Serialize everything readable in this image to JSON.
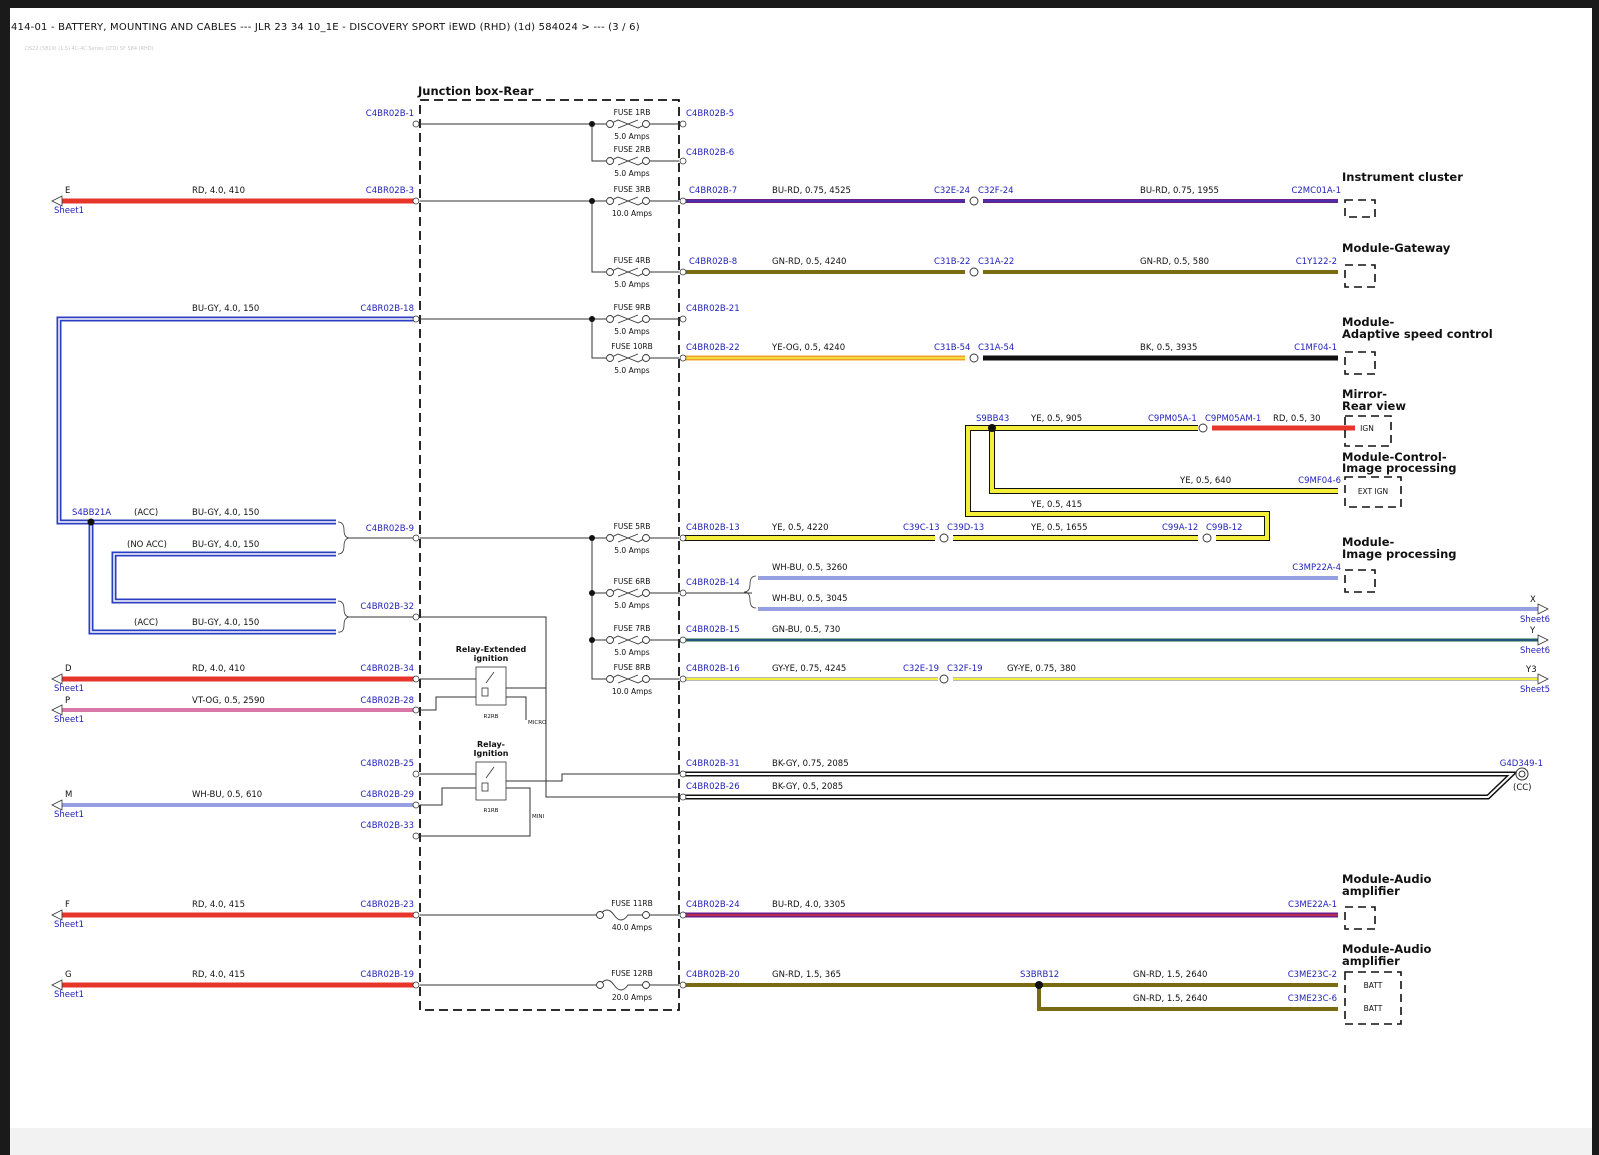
{
  "header": {
    "title": "414-01 - BATTERY, MOUNTING AND CABLES --- JLR 23 34 10_1E - DISCOVERY SPORT iEWD (RHD) (1d) 584024 > --- (3 / 6)",
    "subtitle": "DS22 (5819) (1.5) 4C-4C Series (LTD) 5F 584 (RHD)"
  },
  "junction_box": {
    "title": "Junction box-Rear",
    "relay_extended": [
      "Relay-Extended",
      "ignition"
    ],
    "relay_extended_id": "R2RB",
    "relay_extended_note": "MICRO",
    "relay_ignition": [
      "Relay-",
      "Ignition"
    ],
    "relay_ignition_id": "R1RB",
    "relay_ignition_note": "MINI"
  },
  "fuses": [
    {
      "name": "FUSE 1RB",
      "rating": "5.0 Amps"
    },
    {
      "name": "FUSE 2RB",
      "rating": "5.0 Amps"
    },
    {
      "name": "FUSE 3RB",
      "rating": "10.0 Amps"
    },
    {
      "name": "FUSE 4RB",
      "rating": "5.0 Amps"
    },
    {
      "name": "FUSE 9RB",
      "rating": "5.0 Amps"
    },
    {
      "name": "FUSE 10RB",
      "rating": "5.0 Amps"
    },
    {
      "name": "FUSE 5RB",
      "rating": "5.0 Amps"
    },
    {
      "name": "FUSE 6RB",
      "rating": "5.0 Amps"
    },
    {
      "name": "FUSE 7RB",
      "rating": "5.0 Amps"
    },
    {
      "name": "FUSE 8RB",
      "rating": "10.0 Amps"
    },
    {
      "name": "FUSE 11RB",
      "rating": "40.0 Amps"
    },
    {
      "name": "FUSE 12RB",
      "rating": "20.0 Amps"
    }
  ],
  "left_connectors": {
    "c1": "C4BR02B-1",
    "c3": "C4BR02B-3",
    "c18": "C4BR02B-18",
    "c9": "C4BR02B-9",
    "c32": "C4BR02B-32",
    "c34": "C4BR02B-34",
    "c28": "C4BR02B-28",
    "c25": "C4BR02B-25",
    "c29": "C4BR02B-29",
    "c33": "C4BR02B-33",
    "c23": "C4BR02B-23",
    "c19": "C4BR02B-19"
  },
  "right_connectors": {
    "c5": "C4BR02B-5",
    "c6": "C4BR02B-6",
    "c7": "C4BR02B-7",
    "c8": "C4BR02B-8",
    "c21": "C4BR02B-21",
    "c22": "C4BR02B-22",
    "c13": "C4BR02B-13",
    "c14": "C4BR02B-14",
    "c15": "C4BR02B-15",
    "c16": "C4BR02B-16",
    "c31": "C4BR02B-31",
    "c26": "C4BR02B-26",
    "c24": "C4BR02B-24",
    "c20": "C4BR02B-20"
  },
  "inline_connectors": {
    "c32e24": "C32E-24",
    "c32f24": "C32F-24",
    "c31b22": "C31B-22",
    "c31a22": "C31A-22",
    "c31b54": "C31B-54",
    "c31a54": "C31A-54",
    "c39c13": "C39C-13",
    "c39d13": "C39D-13",
    "c99a12": "C99A-12",
    "c99b12": "C99B-12",
    "c32e19": "C32E-19",
    "c32f19": "C32F-19",
    "c9pm05a1": "C9PM05A-1",
    "c9pm05am1": "C9PM05AM-1"
  },
  "splices": {
    "s4bb21a": "S4BB21A",
    "s9bb43": "S9BB43",
    "s3brb12": "S3BRB12"
  },
  "end_connectors": {
    "c2mc01a1": "C2MC01A-1",
    "c1y1222": "C1Y122-2",
    "c1mf041": "C1MF04-1",
    "c9mf046": "C9MF04-6",
    "c3mp22a4": "C3MP22A-4",
    "c3me22a1": "C3ME22A-1",
    "c3me23c2": "C3ME23C-2",
    "c3me23c6": "C3ME23C-6",
    "g4d3491": "G4D349-1",
    "cc": "(CC)"
  },
  "wires": {
    "w_e": "RD, 4.0, 410",
    "w_18": "BU-GY, 4.0, 150",
    "w_acc1": "BU-GY, 4.0, 150",
    "w_noacc": "BU-GY, 4.0, 150",
    "w_acc2": "BU-GY, 4.0, 150",
    "acc": "(ACC)",
    "noacc": "(NO ACC)",
    "w_d": "RD, 4.0, 410",
    "w_p": "VT-OG, 0.5, 2590",
    "w_m": "WH-BU, 0.5, 610",
    "w_f": "RD, 4.0, 415",
    "w_g": "RD, 4.0, 415",
    "w7a": "BU-RD, 0.75, 4525",
    "w7b": "BU-RD, 0.75, 1955",
    "w8a": "GN-RD, 0.5, 4240",
    "w8b": "GN-RD, 0.5, 580",
    "w22a": "YE-OG, 0.5, 4240",
    "w22b": "BK, 0.5, 3935",
    "w_s9_1": "YE, 0.5, 905",
    "w_s9_2": "RD, 0.5, 30",
    "w_s9_3": "YE, 0.5, 640",
    "w_s9_4": "YE, 0.5, 415",
    "w13a": "YE, 0.5, 4220",
    "w13b": "YE, 0.5, 1655",
    "w14a": "WH-BU, 0.5, 3260",
    "w14b": "WH-BU, 0.5, 3045",
    "w15": "GN-BU, 0.5, 730",
    "w16a": "GY-YE, 0.75, 4245",
    "w16b": "GY-YE, 0.75, 380",
    "w31": "BK-GY, 0.75, 2085",
    "w26": "BK-GY, 0.5, 2085",
    "w24": "BU-RD, 4.0, 3305",
    "w20a": "GN-RD, 1.5, 365",
    "w20b": "GN-RD, 1.5, 2640",
    "w20c": "GN-RD, 1.5, 2640"
  },
  "offsheet": {
    "e": "E",
    "d": "D",
    "p": "P",
    "m": "M",
    "f": "F",
    "g": "G",
    "sheet1": "Sheet1",
    "x": "X",
    "y": "Y",
    "y3": "Y3",
    "sheet6": "Sheet6",
    "sheet5": "Sheet5"
  },
  "modules": {
    "instrument_cluster": [
      "Instrument cluster"
    ],
    "gateway": [
      "Module-Gateway"
    ],
    "adaptive": [
      "Module-",
      "Adaptive speed control"
    ],
    "mirror": [
      "Mirror-",
      "Rear view"
    ],
    "control_image": [
      "Module-Control-",
      "Image processing"
    ],
    "image_processing": [
      "Module-",
      "Image processing"
    ],
    "audio1": [
      "Module-Audio",
      "amplifier"
    ],
    "audio2": [
      "Module-Audio",
      "amplifier"
    ],
    "pin_ign": "IGN",
    "pin_ext_ign": "EXT IGN",
    "pin_batt1": "BATT",
    "pin_batt2": "BATT"
  },
  "colors": {
    "red": "#e8352b",
    "blue": "#2b3fc4",
    "purple": "#6b1f8a",
    "olive": "#7a6a12",
    "orange": "#f0a030",
    "yellow": "#f3ee3a",
    "black": "#111111",
    "pink": "#d877a8",
    "conn_blue": "#2222bb"
  }
}
